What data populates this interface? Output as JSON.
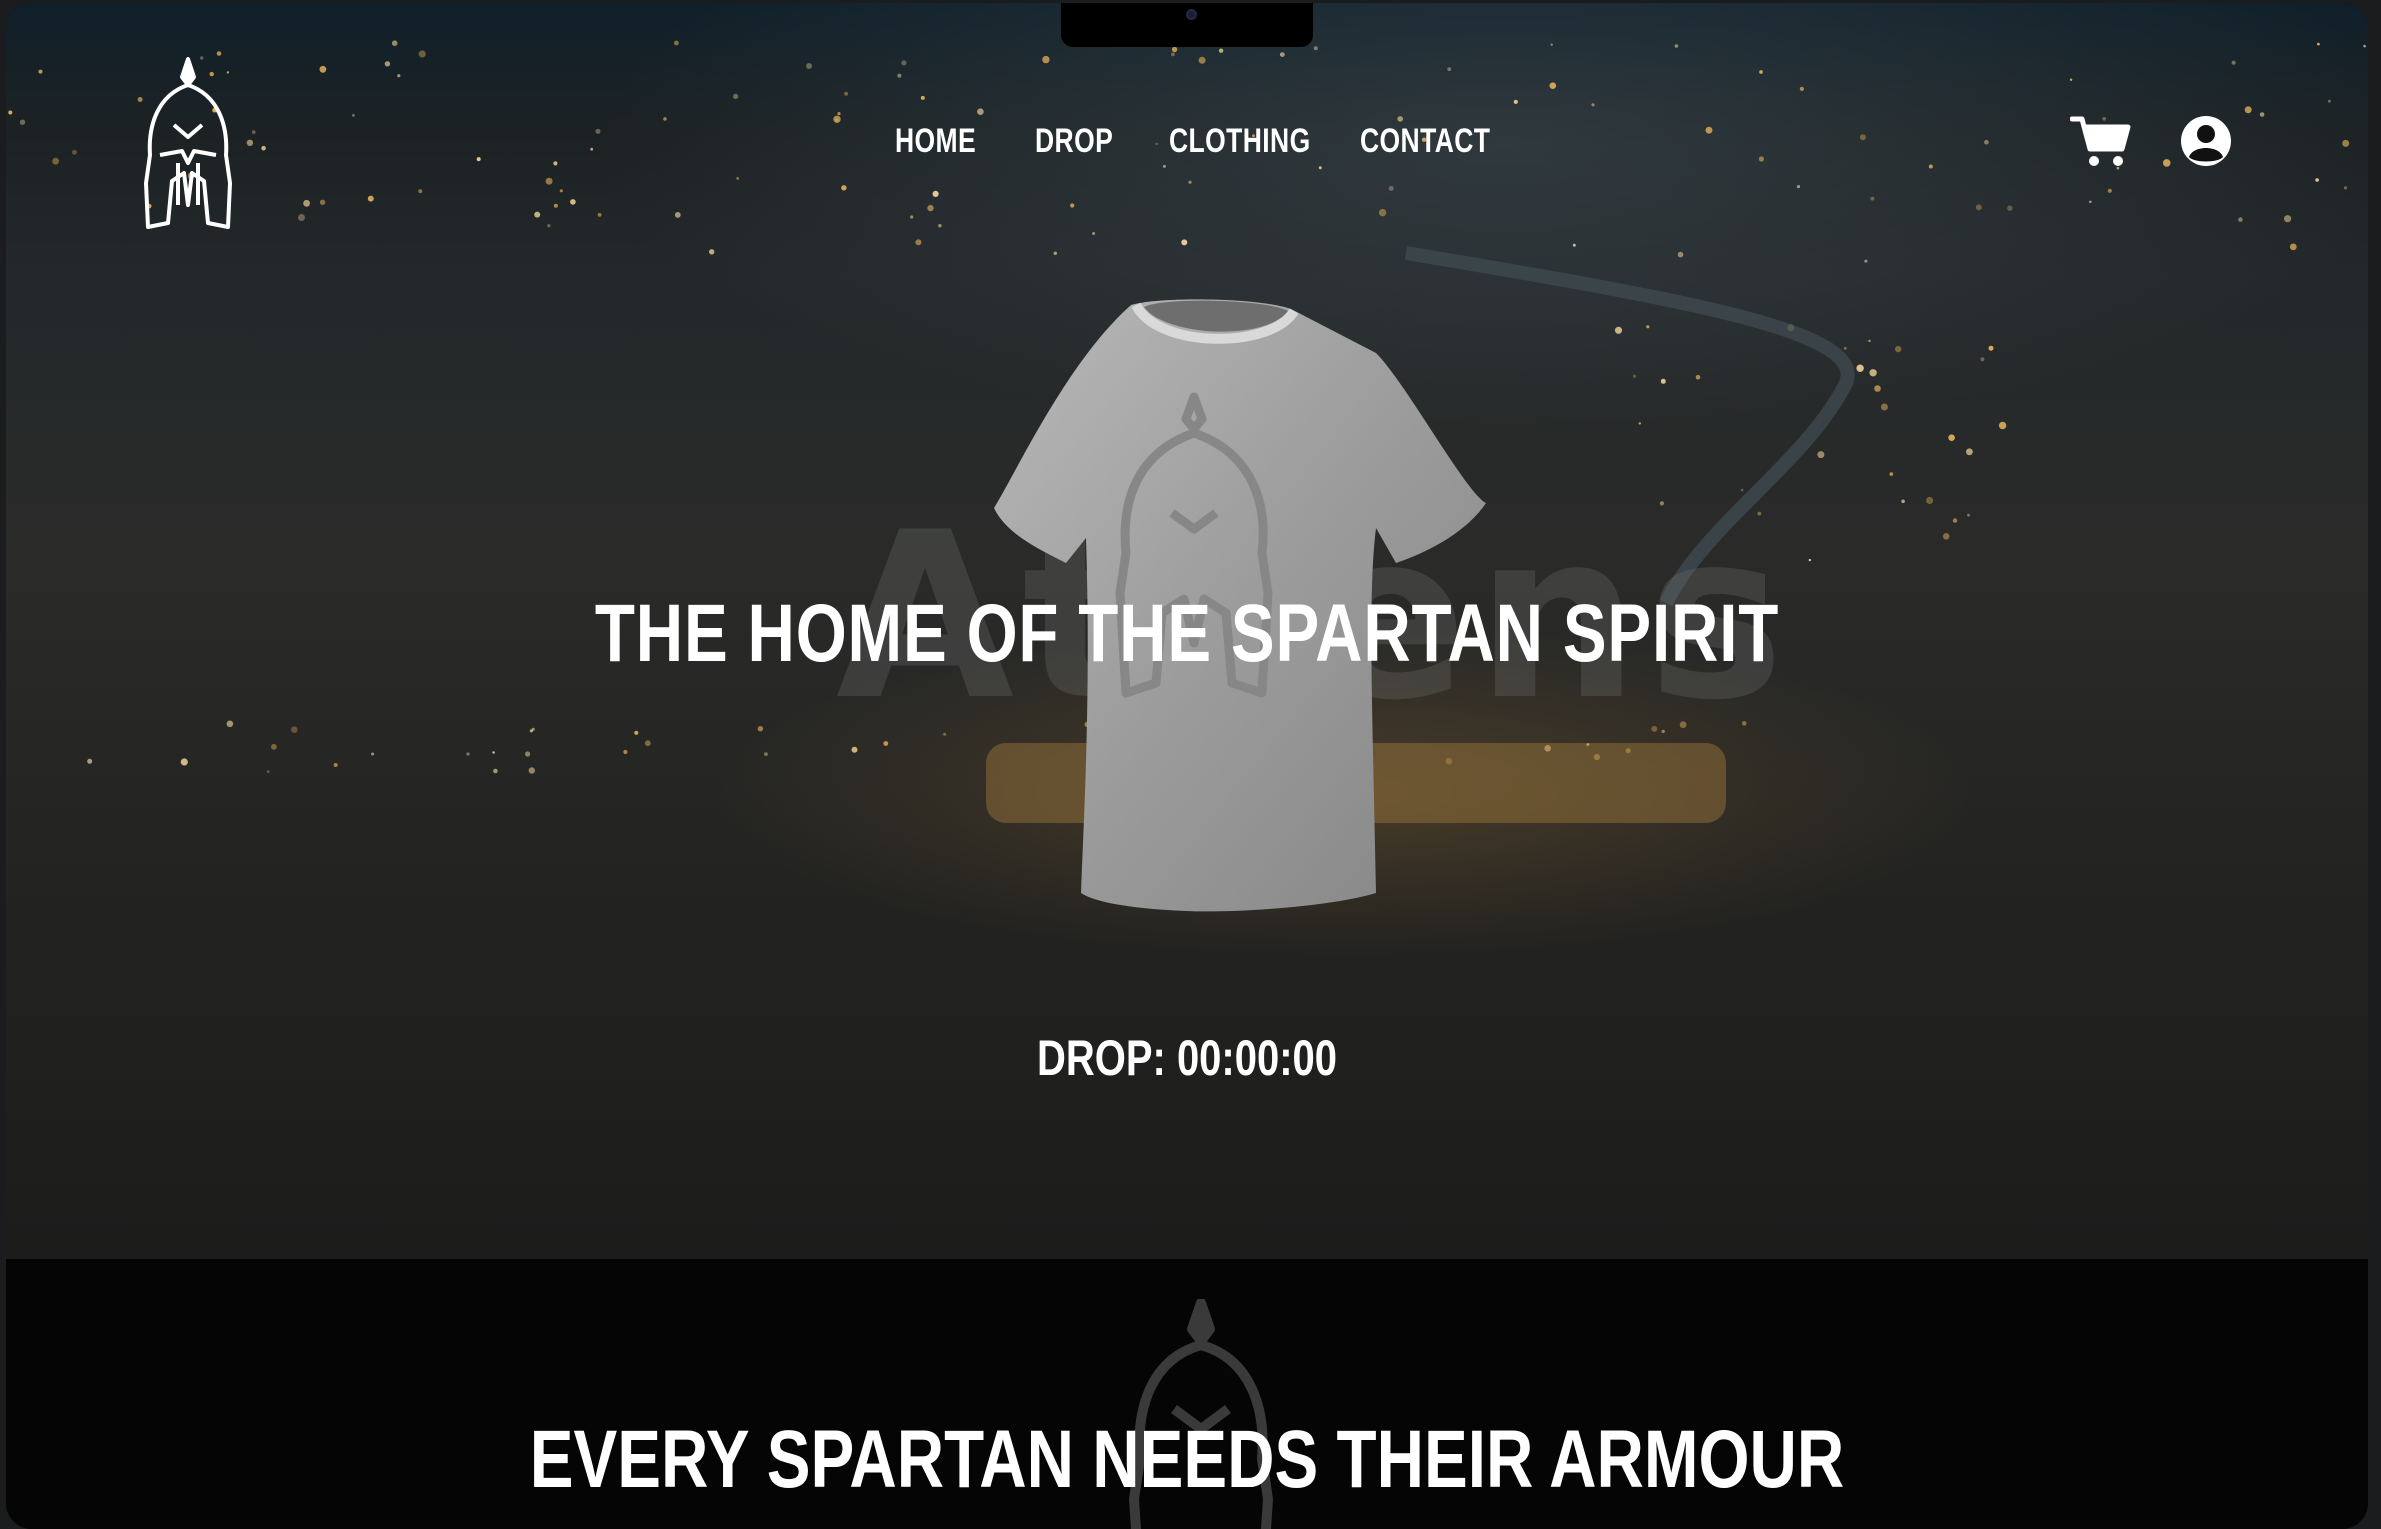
{
  "nav": {
    "items": [
      {
        "label": "HOME"
      },
      {
        "label": "DROP"
      },
      {
        "label": "CLOTHING"
      },
      {
        "label": "CONTACT"
      }
    ]
  },
  "header": {
    "logo_icon": "spartan-helmet-icon",
    "cart_icon": "shopping-cart-icon",
    "account_icon": "user-account-icon"
  },
  "hero": {
    "background_word": "Athens",
    "headline": "THE HOME OF THE SPARTAN SPIRIT",
    "product_image": "t-shirt-with-spartan-helmet-print",
    "countdown": "DROP: 00:00:00"
  },
  "section": {
    "title": "EVERY SPARTAN NEEDS THEIR ARMOUR",
    "icon": "spartan-helmet-icon"
  },
  "colors": {
    "text": "#ffffff",
    "page_bg": "#050505",
    "shirt": "#9e9e9e"
  }
}
